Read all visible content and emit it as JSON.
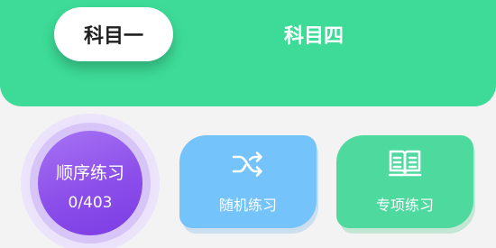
{
  "header": {
    "tabs": [
      {
        "label": "科目一",
        "active": true
      },
      {
        "label": "科目四",
        "active": false
      }
    ]
  },
  "practice": {
    "sequential": {
      "label": "顺序练习",
      "progress": "0/403"
    },
    "random": {
      "label": "随机练习",
      "icon": "shuffle-icon"
    },
    "special": {
      "label": "专项练习",
      "icon": "book-icon"
    }
  },
  "colors": {
    "header_bg": "#3ddb97",
    "sequential_bg": "#8c4eea",
    "random_bg": "#74c3fb",
    "special_bg": "#4ed99f"
  }
}
